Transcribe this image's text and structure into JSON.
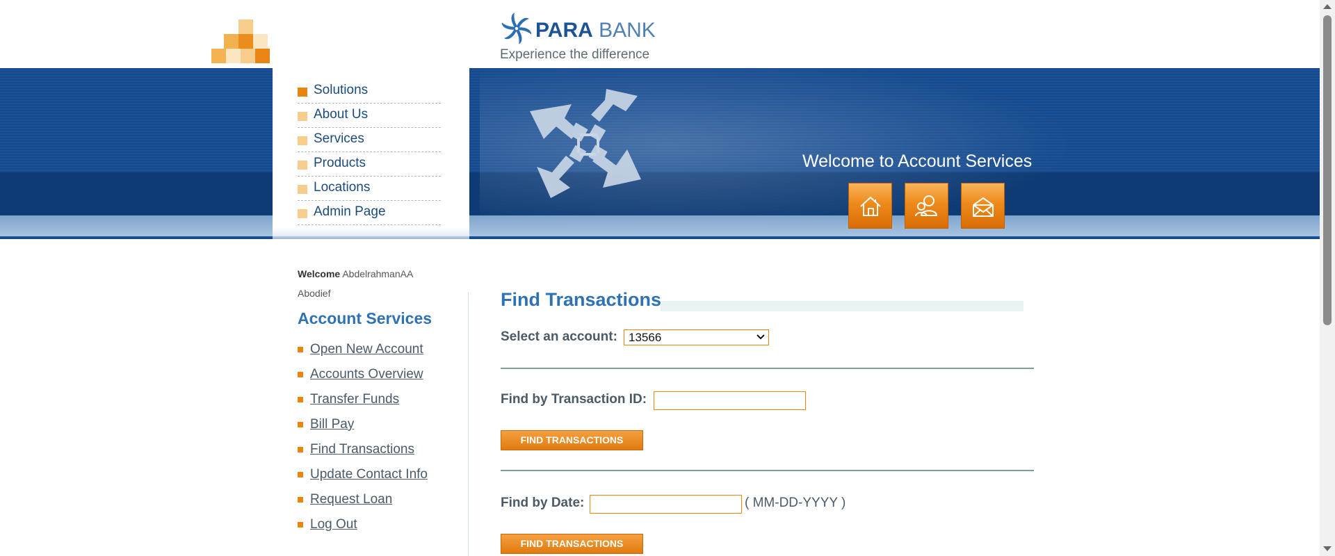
{
  "brand": {
    "name_bold": "PARA",
    "name_light": " BANK",
    "tagline": "Experience the difference"
  },
  "top_menu": [
    {
      "label": "Solutions"
    },
    {
      "label": "About Us"
    },
    {
      "label": "Services"
    },
    {
      "label": "Products"
    },
    {
      "label": "Locations"
    },
    {
      "label": "Admin Page"
    }
  ],
  "banner": {
    "welcome": "Welcome to Account Services",
    "icons": [
      "home-icon",
      "contact-icon",
      "mail-icon"
    ]
  },
  "sidebar": {
    "welcome_label": "Welcome",
    "user_name": "AbdelrahmanAA Abodief",
    "section_title": "Account Services",
    "links": [
      {
        "label": "Open New Account"
      },
      {
        "label": "Accounts Overview"
      },
      {
        "label": "Transfer Funds"
      },
      {
        "label": "Bill Pay"
      },
      {
        "label": "Find Transactions"
      },
      {
        "label": "Update Contact Info"
      },
      {
        "label": "Request Loan"
      },
      {
        "label": "Log Out"
      }
    ]
  },
  "main": {
    "title": "Find Transactions",
    "select_account_label": "Select an account",
    "selected_account": "13566",
    "find_by_id_label": "Find by Transaction ID",
    "find_by_id_value": "",
    "find_by_date_label": "Find by Date",
    "find_by_date_value": "",
    "date_hint": "( MM-DD-YYYY )",
    "find_button_label": "FIND TRANSACTIONS"
  },
  "colors": {
    "accent_orange": "#e8850e",
    "header_blue": "#1b5196",
    "title_blue": "#2f72b4"
  }
}
